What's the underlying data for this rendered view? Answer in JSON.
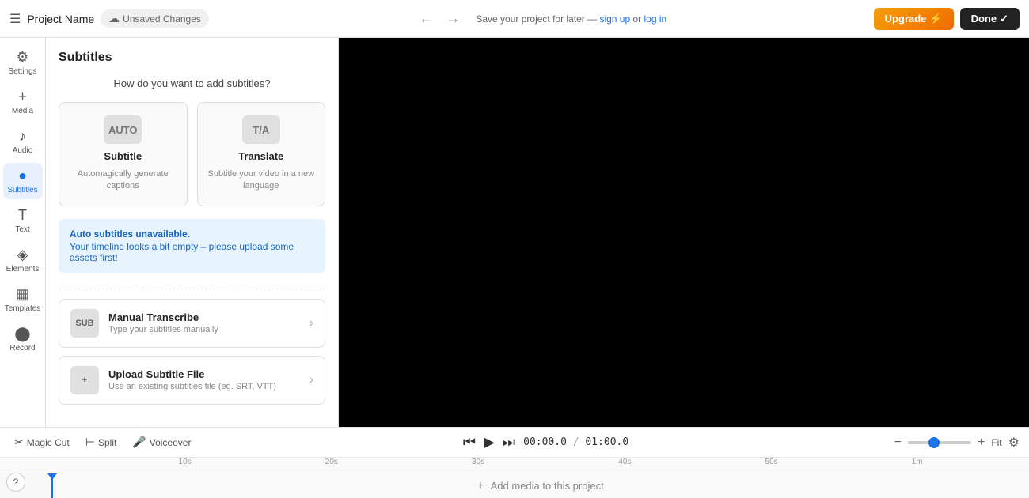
{
  "topbar": {
    "menu_icon": "☰",
    "project_name": "Project Name",
    "unsaved_label": "Unsaved Changes",
    "cloud_icon": "☁",
    "undo_icon": "←",
    "redo_icon": "→",
    "save_text": "Save your project for later —",
    "sign_up_label": "sign up",
    "or_label": "or",
    "log_in_label": "log in",
    "upgrade_label": "Upgrade",
    "upgrade_icon": "⚡",
    "done_label": "Done",
    "done_icon": "✓"
  },
  "sidebar": {
    "items": [
      {
        "id": "settings",
        "icon": "⚙",
        "label": "Settings"
      },
      {
        "id": "media",
        "icon": "+",
        "label": "Media"
      },
      {
        "id": "audio",
        "icon": "♪",
        "label": "Audio"
      },
      {
        "id": "subtitles",
        "icon": "●",
        "label": "Subtitles",
        "active": true
      },
      {
        "id": "text",
        "icon": "T",
        "label": "Text"
      },
      {
        "id": "elements",
        "icon": "◈",
        "label": "Elements"
      },
      {
        "id": "templates",
        "icon": "▦",
        "label": "Templates"
      },
      {
        "id": "record",
        "icon": "⬤",
        "label": "Record"
      }
    ]
  },
  "panel": {
    "title": "Subtitles",
    "subtitle": "How do you want to add subtitles?",
    "option1": {
      "icon_text": "AUTO",
      "label": "Subtitle",
      "desc": "Automagically generate captions"
    },
    "option2": {
      "icon_text": "T/A",
      "label": "Translate",
      "desc": "Subtitle your video in a new language"
    },
    "alert": {
      "title": "Auto subtitles unavailable.",
      "desc": "Your timeline looks a bit empty – please upload some assets first!"
    },
    "manual": {
      "icon_text": "SUB",
      "title": "Manual Transcribe",
      "desc": "Type your subtitles manually",
      "chevron": "›"
    },
    "upload": {
      "icon_text": "+",
      "title": "Upload Subtitle File",
      "desc": "Use an existing subtitles file (eg. SRT, VTT)",
      "chevron": "›"
    }
  },
  "timeline": {
    "magic_cut_icon": "✂",
    "magic_cut_label": "Magic Cut",
    "split_icon": "⊢",
    "split_label": "Split",
    "voiceover_icon": "🎤",
    "voiceover_label": "Voiceover",
    "rewind_icon": "⏮",
    "play_icon": "▶",
    "fastforward_icon": "⏭",
    "current_time": "00:00.0",
    "separator": "/",
    "total_time": "01:00.0",
    "zoom_out_icon": "−",
    "zoom_in_icon": "+",
    "fit_label": "Fit",
    "settings_icon": "⚙",
    "add_media_plus": "+",
    "add_media_label": "Add media to this project",
    "ruler_marks": [
      "10s",
      "20s",
      "30s",
      "40s",
      "50s",
      "1m"
    ]
  }
}
